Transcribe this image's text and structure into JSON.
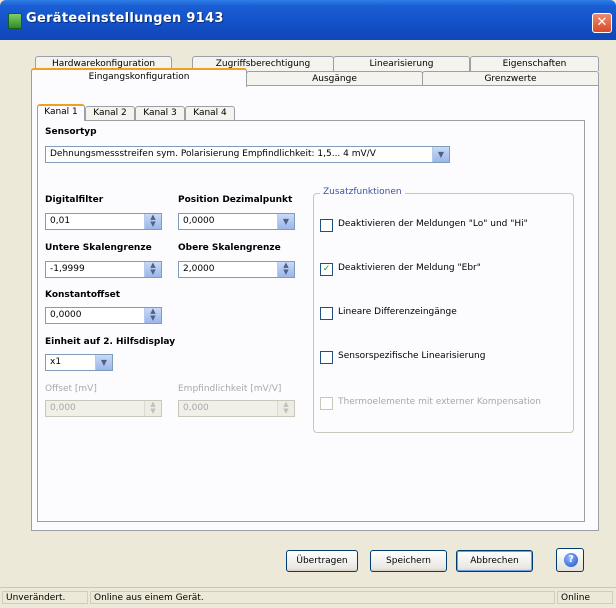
{
  "window": {
    "title": "Geräteeinstellungen 9143"
  },
  "tabs_back_row": [
    {
      "label": "Hardwarekonfiguration"
    },
    {
      "label": "Zugriffsberechtigung"
    },
    {
      "label": "Linearisierung"
    },
    {
      "label": "Eigenschaften"
    }
  ],
  "tabs_front_row": [
    {
      "label": "Eingangskonfiguration",
      "active": true
    },
    {
      "label": "Ausgänge"
    },
    {
      "label": "Grenzwerte"
    }
  ],
  "channel_tabs": [
    {
      "label": "Kanal 1",
      "active": true
    },
    {
      "label": "Kanal 2"
    },
    {
      "label": "Kanal 3"
    },
    {
      "label": "Kanal 4"
    }
  ],
  "sensor": {
    "label": "Sensortyp",
    "value": "Dehnungsmessstreifen sym. Polarisierung Empfindlichkeit: 1,5... 4 mV/V"
  },
  "fields": {
    "digitalfilter": {
      "label": "Digitalfilter",
      "value": "0,01"
    },
    "decimal_point": {
      "label": "Position Dezimalpunkt",
      "value": "0,0000"
    },
    "lower_scale": {
      "label": "Untere Skalengrenze",
      "value": "-1,9999"
    },
    "upper_scale": {
      "label": "Obere Skalengrenze",
      "value": "2,0000"
    },
    "constant_offset": {
      "label": "Konstantoffset",
      "value": "0,0000"
    },
    "unit_display": {
      "label": "Einheit auf 2. Hilfsdisplay",
      "value": "x1"
    },
    "offset": {
      "label": "Offset [mV]",
      "value": "0,000"
    },
    "sensitivity": {
      "label": "Empfindlichkeit [mV/V]",
      "value": "0,000"
    }
  },
  "additional_functions": {
    "title": "Zusatzfunktionen",
    "options": [
      {
        "label": "Deaktivieren der Meldungen \"Lo\" und \"Hi\"",
        "checked": false,
        "enabled": true
      },
      {
        "label": "Deaktivieren der Meldung \"Ebr\"",
        "checked": true,
        "enabled": true
      },
      {
        "label": "Lineare Differenzeingänge",
        "checked": false,
        "enabled": true
      },
      {
        "label": "Sensorspezifische Linearisierung",
        "checked": false,
        "enabled": true
      },
      {
        "label": "Thermoelemente mit externer Kompensation",
        "checked": false,
        "enabled": false
      }
    ]
  },
  "buttons": {
    "transfer": "Übertragen",
    "save": "Speichern",
    "cancel": "Abbrechen"
  },
  "status": {
    "state": "Unverändert.",
    "source": "Online aus einem Gerät.",
    "mode": "Online"
  },
  "icons": {
    "app": "app-icon",
    "close": "close-icon",
    "help": "help-icon",
    "combo": "chevron-down-icon",
    "spin": "spin-arrows-icon",
    "check": "checkmark-icon"
  },
  "colors": {
    "titlebar": "#1451c8",
    "active_tab_accent": "#f0a020",
    "checkmark": "#1e9a1e"
  }
}
